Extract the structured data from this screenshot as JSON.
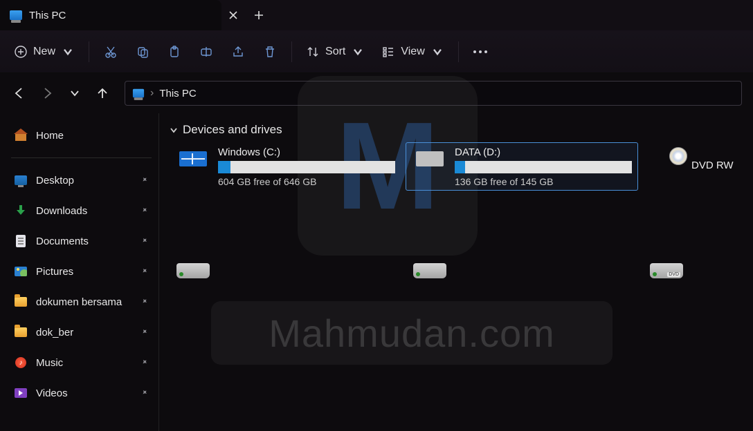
{
  "tab": {
    "title": "This PC"
  },
  "toolbar": {
    "new": "New",
    "sort": "Sort",
    "view": "View"
  },
  "breadcrumb": {
    "root": "This PC"
  },
  "sidebar": {
    "home": "Home",
    "items": [
      {
        "label": "Desktop",
        "icon": "desktop"
      },
      {
        "label": "Downloads",
        "icon": "down"
      },
      {
        "label": "Documents",
        "icon": "doc"
      },
      {
        "label": "Pictures",
        "icon": "pic"
      },
      {
        "label": "dokumen bersama",
        "icon": "folder"
      },
      {
        "label": "dok_ber",
        "icon": "folder"
      },
      {
        "label": "Music",
        "icon": "music"
      },
      {
        "label": "Videos",
        "icon": "video"
      }
    ]
  },
  "group": {
    "header": "Devices and drives"
  },
  "drives": [
    {
      "name": "Windows (C:)",
      "free_text": "604 GB free of 646 GB",
      "used_pct": 7,
      "icon": "win",
      "selected": false
    },
    {
      "name": "DATA (D:)",
      "free_text": "136 GB free of 145 GB",
      "used_pct": 6,
      "icon": "data",
      "selected": true
    },
    {
      "name": "DVD RW",
      "free_text": "",
      "used_pct": 0,
      "icon": "dvd",
      "selected": false
    }
  ],
  "watermark": "Mahmudan.com"
}
